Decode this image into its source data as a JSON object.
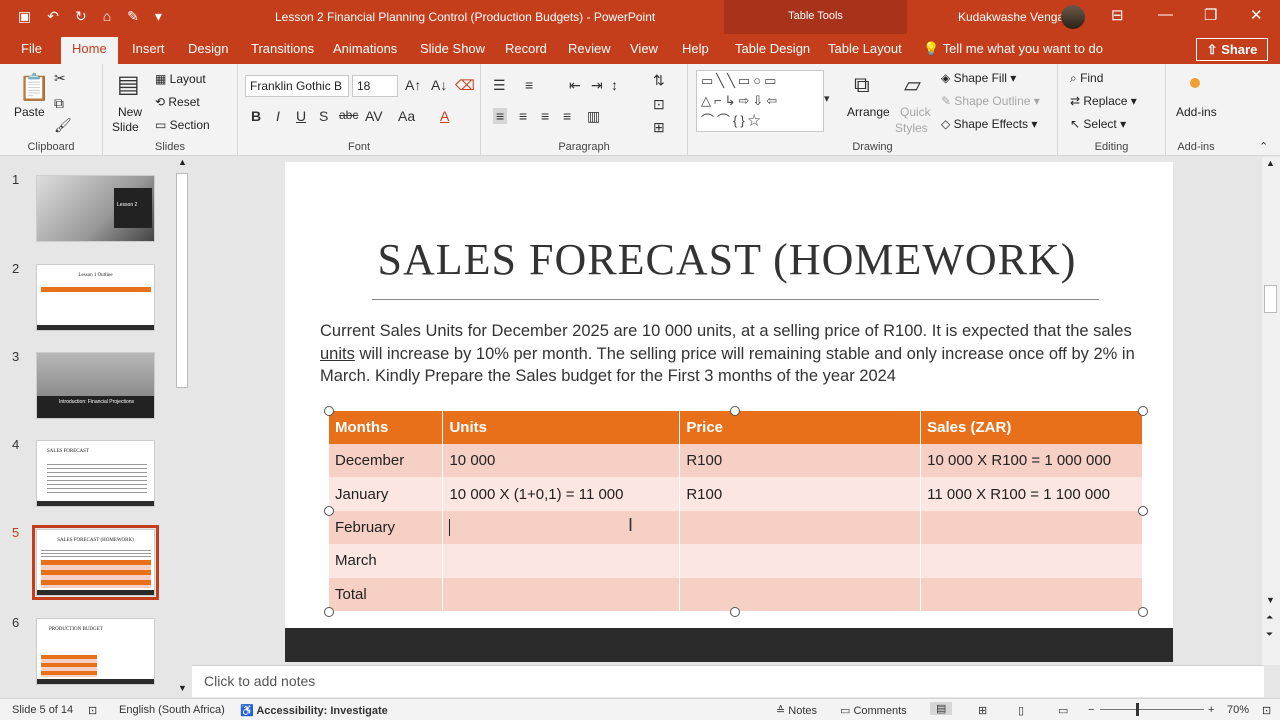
{
  "titlebar": {
    "doc_title": "Lesson 2 Financial Planning Control (Production Budgets)  -  PowerPoint",
    "table_tools": "Table Tools",
    "user": "Kudakwashe Vengai"
  },
  "tabs": [
    "File",
    "Home",
    "Insert",
    "Design",
    "Transitions",
    "Animations",
    "Slide Show",
    "Record",
    "Review",
    "View",
    "Help",
    "Table Design",
    "Table Layout"
  ],
  "tell_me": "Tell me what you want to do",
  "share": "Share",
  "ribbon": {
    "clipboard": {
      "label": "Clipboard",
      "paste": "Paste"
    },
    "slides": {
      "label": "Slides",
      "new_slide": "New",
      "new_slide2": "Slide",
      "layout": "Layout",
      "reset": "Reset",
      "section": "Section"
    },
    "font": {
      "label": "Font",
      "family": "Franklin Gothic B",
      "size": "18"
    },
    "paragraph": {
      "label": "Paragraph"
    },
    "drawing": {
      "label": "Drawing",
      "arrange": "Arrange",
      "quick_styles": "Quick",
      "quick_styles2": "Styles",
      "shape_fill": "Shape Fill",
      "shape_outline": "Shape Outline",
      "shape_effects": "Shape Effects"
    },
    "editing": {
      "label": "Editing",
      "find": "Find",
      "replace": "Replace",
      "select": "Select"
    },
    "addins": {
      "label": "Add-ins",
      "addins_btn": "Add-ins"
    }
  },
  "thumbnails": [
    {
      "num": "1",
      "caption": "Lesson 2"
    },
    {
      "num": "2",
      "caption": "Lesson 1 Outline"
    },
    {
      "num": "3",
      "caption": "Introduction: Financial Projections"
    },
    {
      "num": "4",
      "caption": "SALES FORECAST"
    },
    {
      "num": "5",
      "caption": "SALES FORECAST (HOMEWORK)"
    },
    {
      "num": "6",
      "caption": "PRODUCTION BUDGET"
    }
  ],
  "slide": {
    "title": "SALES FORECAST (HOMEWORK)",
    "body_a": "Current Sales Units for December 2025 are 10 000 units, at a selling price of R100. It is expected that the sales ",
    "body_u": "units",
    "body_b": " will increase by 10% per month. The selling price will remaining stable and only increase once off by 2% in March. Kindly Prepare the Sales budget for the First 3 months of the year 2024",
    "table": {
      "headers": [
        "Months",
        "Units",
        "Price",
        "Sales (ZAR)"
      ],
      "rows": [
        [
          "December",
          "10 000",
          "R100",
          "10 000 X R100 = 1 000 000"
        ],
        [
          "January",
          "10 000 X (1+0,1) = 11 000",
          "R100",
          "11 000 X R100 = 1 100 000"
        ],
        [
          "February",
          "",
          "",
          ""
        ],
        [
          "March",
          "",
          "",
          ""
        ],
        [
          "Total",
          "",
          "",
          ""
        ]
      ]
    }
  },
  "notes_placeholder": "Click to add notes",
  "status": {
    "slide_of": "Slide 5 of 14",
    "language": "English (South Africa)",
    "accessibility": "Accessibility: Investigate",
    "notes": "Notes",
    "comments": "Comments",
    "zoom": "70%"
  }
}
